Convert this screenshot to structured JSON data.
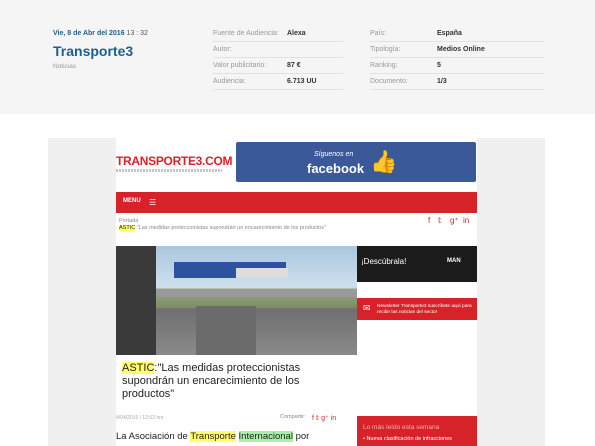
{
  "header": {
    "date": "Vie, 8 de Abr del 2016",
    "time": "13 : 32",
    "medium": "Transporte3",
    "section": "Noticias"
  },
  "meta_left": [
    {
      "label": "Fuente de Audiencia:",
      "value": "Alexa"
    },
    {
      "label": "Autor:",
      "value": ""
    },
    {
      "label": "Valor publicitario:",
      "value": "87 €"
    },
    {
      "label": "Audiencia:",
      "value": "6.713 UU"
    }
  ],
  "meta_right": [
    {
      "label": "País:",
      "value": "España"
    },
    {
      "label": "Tipología:",
      "value": "Medios Online"
    },
    {
      "label": "Ranking:",
      "value": "5"
    },
    {
      "label": "Documento:",
      "value": "1/3"
    }
  ],
  "site": {
    "logo": "TRANSPORTE3.COM",
    "fb_follow": "Síguenos en",
    "fb_name": "facebook",
    "menu_label": "MENU",
    "crumb_pre": "Portada",
    "crumb_hl": "ASTIC",
    "crumb_post": ":\"Las medidas proteccionistas supondrán un encarecimiento de los productos\"",
    "ad1_text": "¡Descúbrala!",
    "ad1_brand": "MAN",
    "ad2_text": "Newsletter Transporte3 suscríbete aquí para recibir las noticias del sector",
    "title_hl": "ASTIC",
    "title_rest": ":\"Las medidas proteccionistas supondrán un encarecimiento de los productos\"",
    "byline": "4/04/2016 / 12:53 hrs",
    "share_label": "Compartir:",
    "body_pre": "La Asociación de ",
    "body_hl1": "Transporte",
    "body_sp": " ",
    "body_hl2": "Internacional",
    "body_post": " por",
    "mostread_a": "Lo más leído",
    "mostread_b": " esta semana",
    "mostread_item": "• Nueva clasificación de infracciones"
  },
  "colors": {
    "brand_red": "#d8222a",
    "link_blue": "#1f5f8b",
    "facebook": "#3b5998"
  }
}
